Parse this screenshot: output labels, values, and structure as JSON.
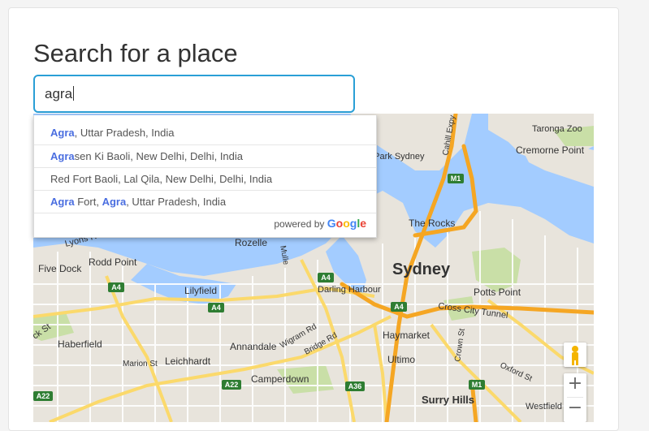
{
  "page": {
    "title": "Search for a place"
  },
  "search": {
    "value": "agra"
  },
  "suggestions": [
    {
      "parts": [
        {
          "t": "Agra",
          "m": true
        },
        {
          "t": ", Uttar Pradesh, India",
          "m": false
        }
      ]
    },
    {
      "parts": [
        {
          "t": "Agra",
          "m": true
        },
        {
          "t": "sen Ki Baoli, New Delhi, Delhi, India",
          "m": false
        }
      ]
    },
    {
      "parts": [
        {
          "t": "Red Fort Baoli, Lal Qila, New Delhi, Delhi, India",
          "m": false
        }
      ]
    },
    {
      "parts": [
        {
          "t": "Agra",
          "m": true
        },
        {
          "t": " Fort, ",
          "m": false
        },
        {
          "t": "Agra",
          "m": true
        },
        {
          "t": ", Uttar Pradesh, India",
          "m": false
        }
      ]
    }
  ],
  "powered_by": {
    "prefix": "powered by",
    "brand": "Google",
    "brand_colors": [
      "#4285F4",
      "#EA4335",
      "#FBBC05",
      "#4285F4",
      "#34A853",
      "#EA4335"
    ]
  },
  "map": {
    "colors": {
      "water": "#a3ccff",
      "land": "#e8e4dc",
      "park": "#c9dfa7",
      "highway": "#f5a623",
      "arterial": "#fbd96b",
      "street": "#ffffff",
      "label": "#333333"
    },
    "labels": {
      "taronga_zoo": "Taronga Zoo",
      "cremorne_point": "Cremorne Point",
      "park_sydney": "a Park Sydney",
      "cahill_expy": "Cahill Expy",
      "the_rocks": "The Rocks",
      "lyons_rd": "Lyons R",
      "rozelle": "Rozelle",
      "five_dock": "Five Dock",
      "rodd_point": "Rodd Point",
      "lilyfield": "Lilyfield",
      "sydney": "Sydney",
      "darling_harbour": "Darling Harbour",
      "potts_point": "Potts Point",
      "cross_city_tunnel": "Cross City Tunnel",
      "haberfield": "Haberfield",
      "annandale": "Annandale",
      "wigram_rd": "Wigram Rd",
      "bridge_rd": "Bridge Rd",
      "haymarket": "Haymarket",
      "marion_st": "Marion St",
      "leichhardt": "Leichhardt",
      "ultimo": "Ultimo",
      "crown_st": "Crown St",
      "oxford_st": "Oxford St",
      "camperdown": "Camperdown",
      "surry_hills": "Surry Hills",
      "westfield": "Westfield",
      "ck_st": "ck St",
      "mullens": "Mulle",
      "shield_a4_1": "A4",
      "shield_a4_2": "A4",
      "shield_a4_3": "A4",
      "shield_a4_4": "A4",
      "shield_a22": "A22",
      "shield_a22_2": "A22",
      "shield_a36": "A36",
      "shield_m1_1": "M1",
      "shield_m1_2": "M1"
    },
    "zoom_in": "+",
    "zoom_out": "−"
  }
}
